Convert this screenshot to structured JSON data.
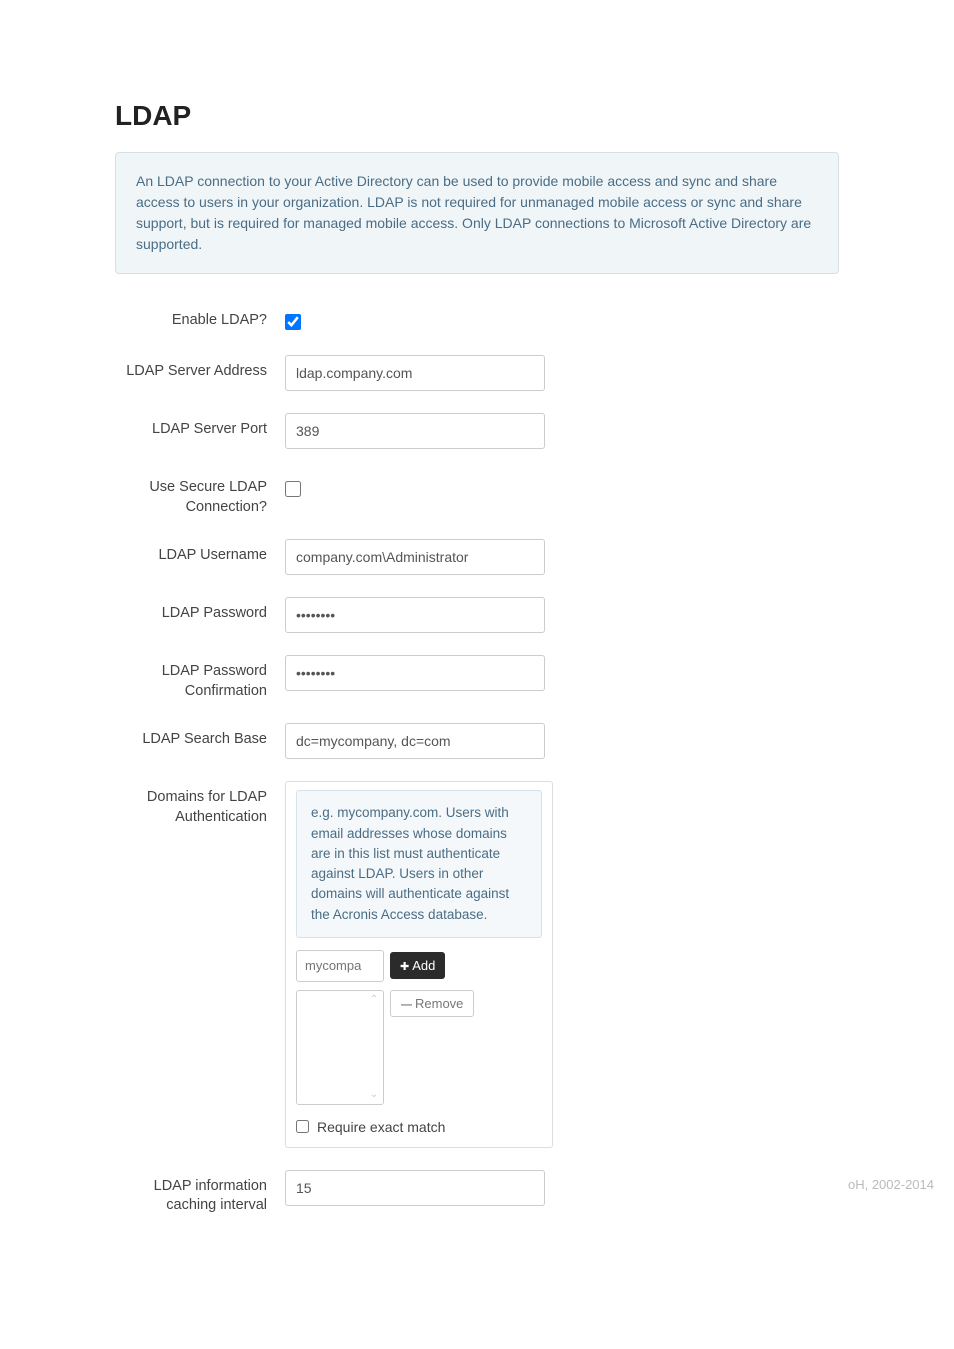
{
  "page": {
    "title": "LDAP",
    "info_text": "An LDAP connection to your Active Directory can be used to provide mobile access and sync and share access to users in your organization. LDAP is not required for unmanaged mobile access or sync and share support, but is required for managed mobile access. Only LDAP connections to Microsoft Active Directory are supported."
  },
  "form": {
    "enable_ldap": {
      "label": "Enable LDAP?",
      "checked": true
    },
    "server_address": {
      "label": "LDAP Server Address",
      "value": "ldap.company.com"
    },
    "server_port": {
      "label": "LDAP Server Port",
      "value": "389"
    },
    "use_secure": {
      "label": "Use Secure LDAP Connection?",
      "checked": false
    },
    "username": {
      "label": "LDAP Username",
      "value": "company.com\\Administrator"
    },
    "password": {
      "label": "LDAP Password",
      "value": "••••••••"
    },
    "password_confirm": {
      "label": "LDAP Password Confirmation",
      "value": "••••••••"
    },
    "search_base": {
      "label": "LDAP Search Base",
      "value": "dc=mycompany, dc=com"
    },
    "domains": {
      "label": "Domains for LDAP Authentication",
      "help_text": "e.g. mycompany.com. Users with email addresses whose domains are in this list must authenticate against LDAP. Users in other domains will authenticate against the Acronis Access database.",
      "input_placeholder": "mycompa",
      "add_label": "Add",
      "remove_label": "Remove",
      "exact_match_label": "Require exact match",
      "exact_match_checked": false
    },
    "caching_interval": {
      "label": "LDAP information caching interval",
      "value": "15"
    }
  },
  "footer": {
    "copyright": "oH, 2002-2014"
  }
}
